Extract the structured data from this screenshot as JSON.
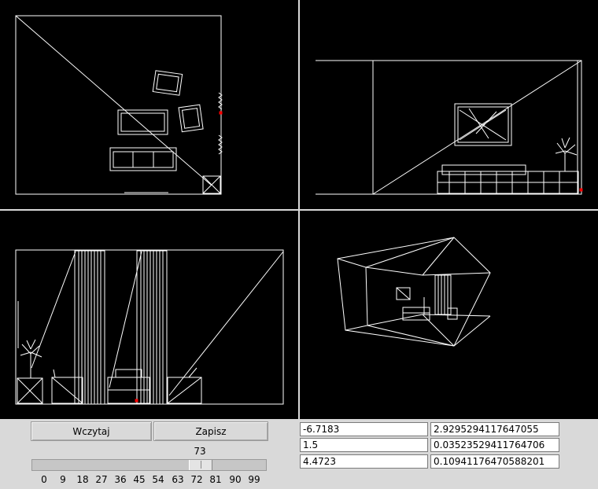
{
  "viewports": [
    {
      "name": "top-view"
    },
    {
      "name": "front-view"
    },
    {
      "name": "side-view"
    },
    {
      "name": "perspective-view"
    }
  ],
  "buttons": {
    "load_label": "Wczytaj",
    "save_label": "Zapisz"
  },
  "slider": {
    "value": "73",
    "value_fraction": 0.73,
    "ticks": [
      "0",
      "9",
      "18",
      "27",
      "36",
      "45",
      "54",
      "63",
      "72",
      "81",
      "90",
      "99"
    ]
  },
  "fields": {
    "col1": [
      "-6.7183",
      "1.5",
      "4.4723"
    ],
    "col2": [
      "2.9295294117647055",
      "0.03523529411764706",
      "0.10941176470588201"
    ]
  },
  "colors": {
    "background": "#d9d9d9",
    "viewport": "#000000",
    "wire": "#ffffff",
    "marker": "#ff0000"
  }
}
